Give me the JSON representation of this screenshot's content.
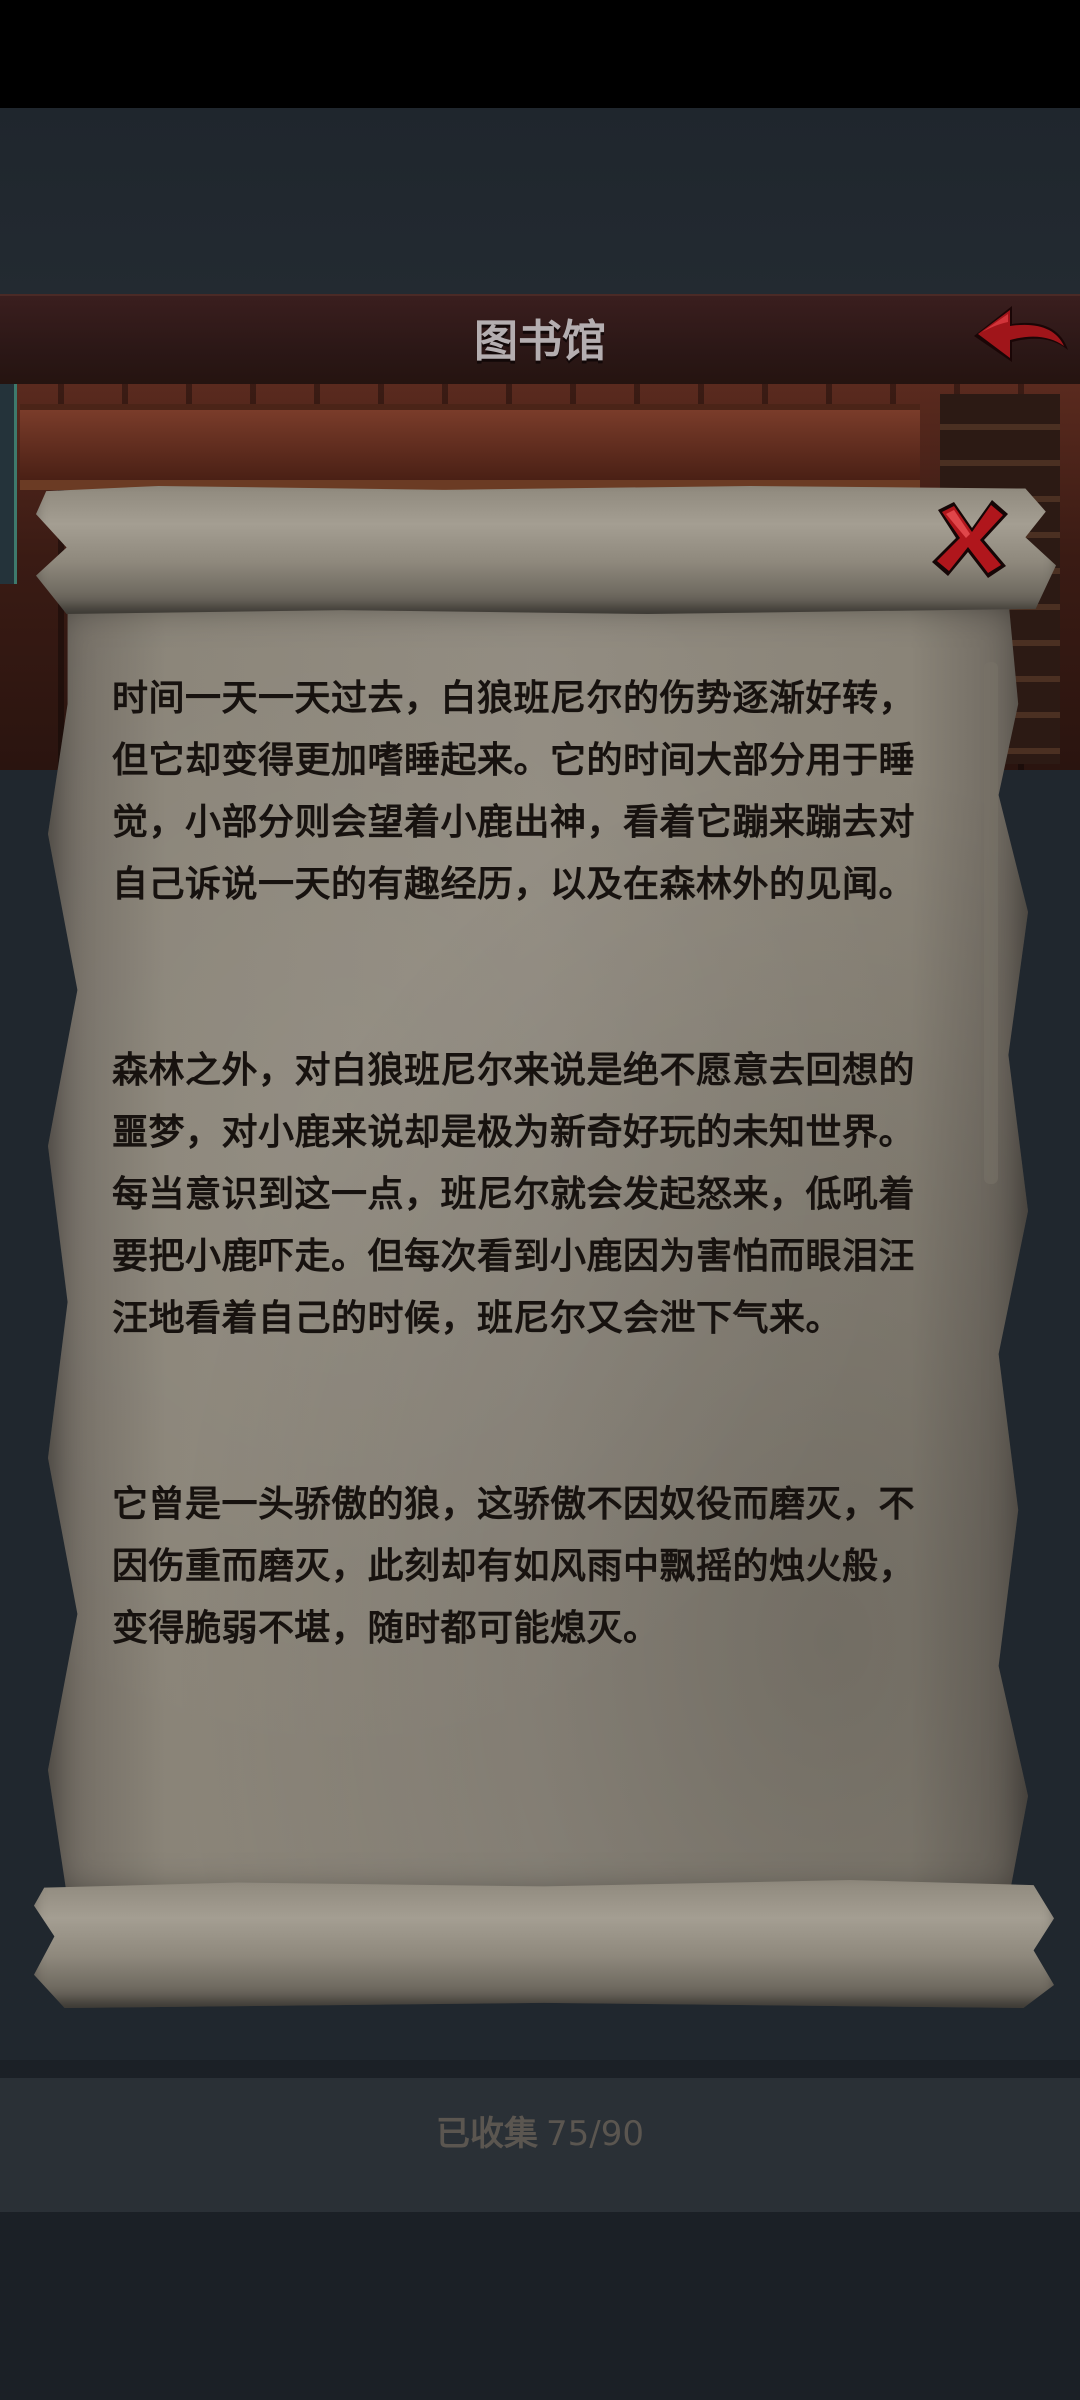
{
  "header": {
    "title": "图书馆"
  },
  "story": {
    "paragraphs": [
      "时间一天一天过去，白狼班尼尔的伤势逐渐好转，\n但它却变得更加嗜睡起来。它的时间大部分用于睡\n觉，小部分则会望着小鹿出神，看着它蹦来蹦去对\n自己诉说一天的有趣经历，以及在森林外的见闻。",
      "森林之外，对白狼班尼尔来说是绝不愿意去回想的\n噩梦，对小鹿来说却是极为新奇好玩的未知世界。\n每当意识到这一点，班尼尔就会发起怒来，低吼着\n要把小鹿吓走。但每次看到小鹿因为害怕而眼泪汪\n汪地看着自己的时候，班尼尔又会泄下气来。",
      "它曾是一头骄傲的狼，这骄傲不因奴役而磨灭，不\n因伤重而磨灭，此刻却有如风雨中飘摇的烛火般，\n变得脆弱不堪，随时都可能熄灭。"
    ]
  },
  "collection": {
    "label": "已收集",
    "count": "75/90"
  },
  "icons": {
    "back": "back-arrow-icon",
    "close": "close-x-icon"
  },
  "colors": {
    "header": "#2b1716",
    "accent_red": "#b0161c",
    "parchment": "#8c8679",
    "text": "#17120f"
  }
}
